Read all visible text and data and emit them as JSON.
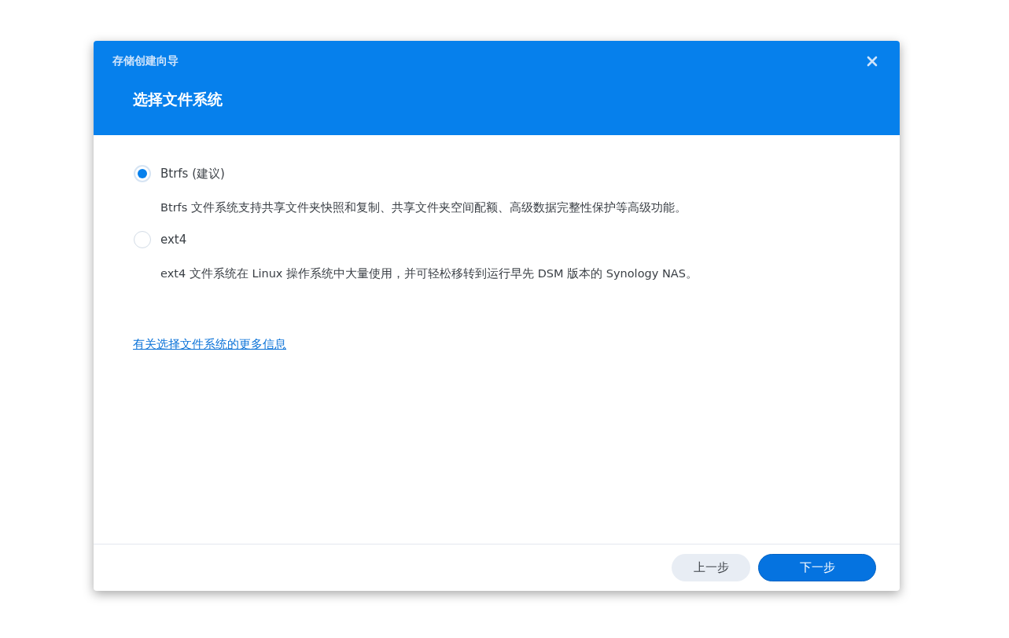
{
  "window": {
    "title": "存储创建向导"
  },
  "header": {
    "heading": "选择文件系统"
  },
  "options": [
    {
      "label": "Btrfs (建议)",
      "description": "Btrfs 文件系统支持共享文件夹快照和复制、共享文件夹空间配额、高级数据完整性保护等高级功能。",
      "selected": true
    },
    {
      "label": "ext4",
      "description": "ext4 文件系统在 Linux 操作系统中大量使用，并可轻松移转到运行早先 DSM 版本的 Synology NAS。",
      "selected": false
    }
  ],
  "link": "有关选择文件系统的更多信息",
  "buttons": [
    {
      "label": "上一步",
      "kind": "secondary"
    },
    {
      "label": "下一步",
      "kind": "primary"
    }
  ]
}
